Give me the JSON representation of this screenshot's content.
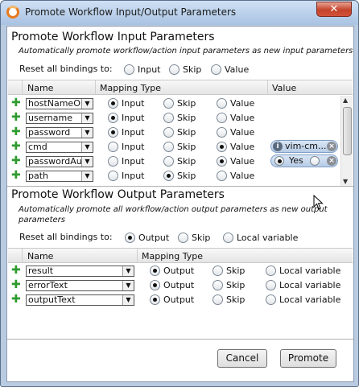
{
  "window": {
    "title": "Promote Workflow Input/Output Parameters",
    "close_glyph": "✕"
  },
  "input_section": {
    "title": "Promote Workflow Input Parameters",
    "subtitle": "Automatically promote workflow/action input parameters as new input parameters",
    "reset_label": "Reset all bindings to:",
    "reset_options": [
      "Input",
      "Skip",
      "Value"
    ],
    "reset_selected": null,
    "columns": [
      "Name",
      "Mapping Type",
      "Value"
    ],
    "row_option_labels": [
      "Input",
      "Skip",
      "Value"
    ],
    "rows": [
      {
        "name": "hostNameOr",
        "selected": "Input"
      },
      {
        "name": "username",
        "selected": "Input"
      },
      {
        "name": "password",
        "selected": "Input"
      },
      {
        "name": "cmd",
        "selected": "Value",
        "value_chip": "vim-cm..."
      },
      {
        "name": "passwordAu",
        "selected": "Value",
        "value_chip": "Yes"
      },
      {
        "name": "path",
        "selected": "Skip"
      }
    ]
  },
  "output_section": {
    "title": "Promote Workflow Output Parameters",
    "subtitle": "Automatically promote all workflow/action output parameters as new output parameters",
    "reset_label": "Reset all bindings to:",
    "reset_options": [
      "Output",
      "Skip",
      "Local variable"
    ],
    "reset_selected": "Output",
    "columns": [
      "Name",
      "Mapping Type"
    ],
    "row_option_labels": [
      "Output",
      "Skip",
      "Local variable"
    ],
    "rows": [
      {
        "name": "result",
        "selected": "Output"
      },
      {
        "name": "errorText",
        "selected": "Output"
      },
      {
        "name": "outputText",
        "selected": "Output"
      }
    ]
  },
  "footer": {
    "cancel_label": "Cancel",
    "promote_label": "Promote"
  },
  "icons": {
    "add": "✚",
    "dropdown": "▼",
    "info": "i",
    "remove": "×"
  },
  "colors": {
    "add_icon": "#2f9b2f",
    "app_icon": "#e87b1e"
  }
}
